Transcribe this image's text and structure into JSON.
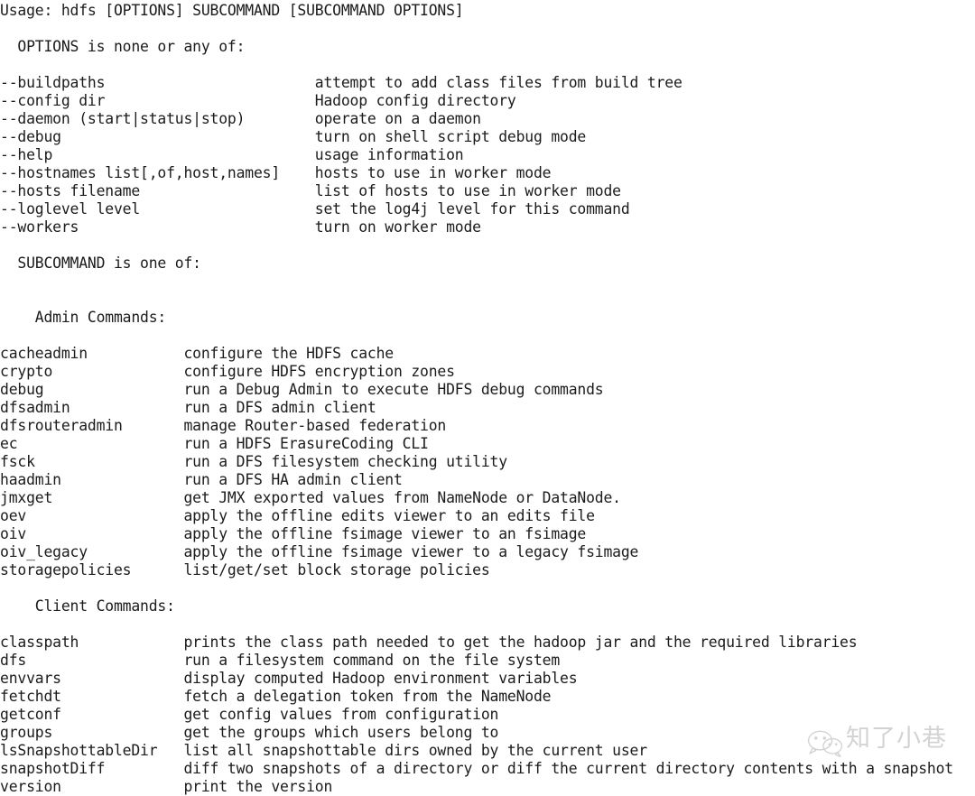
{
  "terminal": {
    "usage_line": "Usage: hdfs [OPTIONS] SUBCOMMAND [SUBCOMMAND OPTIONS]",
    "options_header": "  OPTIONS is none or any of:",
    "subcommand_header": "  SUBCOMMAND is one of:",
    "admin_header": "    Admin Commands:",
    "client_header": "    Client Commands:",
    "colors": {
      "background": "#ffffff",
      "text": "#1b1b1b",
      "watermark": "#b9b9b9"
    },
    "layout": {
      "option_desc_column": 36,
      "command_desc_column": 21
    },
    "options": [
      {
        "flag": "--buildpaths",
        "description": "attempt to add class files from build tree"
      },
      {
        "flag": "--config dir",
        "description": "Hadoop config directory"
      },
      {
        "flag": "--daemon (start|status|stop)",
        "description": "operate on a daemon"
      },
      {
        "flag": "--debug",
        "description": "turn on shell script debug mode"
      },
      {
        "flag": "--help",
        "description": "usage information"
      },
      {
        "flag": "--hostnames list[,of,host,names]",
        "description": "hosts to use in worker mode"
      },
      {
        "flag": "--hosts filename",
        "description": "list of hosts to use in worker mode"
      },
      {
        "flag": "--loglevel level",
        "description": "set the log4j level for this command"
      },
      {
        "flag": "--workers",
        "description": "turn on worker mode"
      }
    ],
    "admin_commands": [
      {
        "name": "cacheadmin",
        "description": "configure the HDFS cache"
      },
      {
        "name": "crypto",
        "description": "configure HDFS encryption zones"
      },
      {
        "name": "debug",
        "description": "run a Debug Admin to execute HDFS debug commands"
      },
      {
        "name": "dfsadmin",
        "description": "run a DFS admin client"
      },
      {
        "name": "dfsrouteradmin",
        "description": "manage Router-based federation"
      },
      {
        "name": "ec",
        "description": "run a HDFS ErasureCoding CLI"
      },
      {
        "name": "fsck",
        "description": "run a DFS filesystem checking utility"
      },
      {
        "name": "haadmin",
        "description": "run a DFS HA admin client"
      },
      {
        "name": "jmxget",
        "description": "get JMX exported values from NameNode or DataNode."
      },
      {
        "name": "oev",
        "description": "apply the offline edits viewer to an edits file"
      },
      {
        "name": "oiv",
        "description": "apply the offline fsimage viewer to an fsimage"
      },
      {
        "name": "oiv_legacy",
        "description": "apply the offline fsimage viewer to a legacy fsimage"
      },
      {
        "name": "storagepolicies",
        "description": "list/get/set block storage policies"
      }
    ],
    "client_commands": [
      {
        "name": "classpath",
        "description": "prints the class path needed to get the hadoop jar and the required libraries"
      },
      {
        "name": "dfs",
        "description": "run a filesystem command on the file system"
      },
      {
        "name": "envvars",
        "description": "display computed Hadoop environment variables"
      },
      {
        "name": "fetchdt",
        "description": "fetch a delegation token from the NameNode"
      },
      {
        "name": "getconf",
        "description": "get config values from configuration"
      },
      {
        "name": "groups",
        "description": "get the groups which users belong to"
      },
      {
        "name": "lsSnapshottableDir",
        "description": "list all snapshottable dirs owned by the current user"
      },
      {
        "name": "snapshotDiff",
        "description": "diff two snapshots of a directory or diff the current directory contents with a snapshot"
      },
      {
        "name": "version",
        "description": "print the version"
      }
    ]
  },
  "watermark": {
    "text": "知了小巷",
    "icon": "wechat-icon"
  }
}
